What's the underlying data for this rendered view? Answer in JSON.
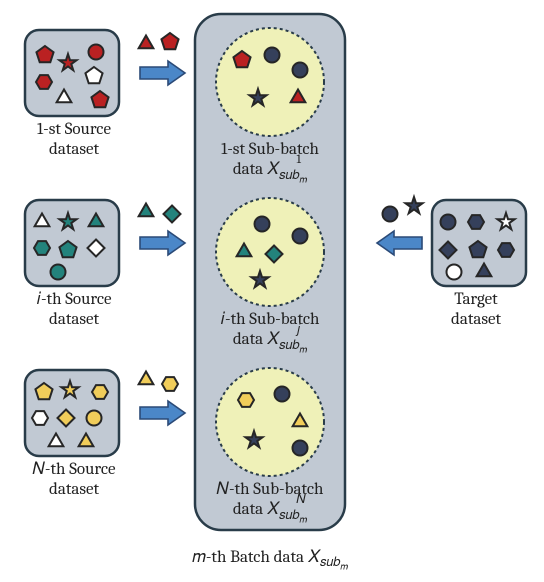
{
  "labels": {
    "source1": "1-st Source",
    "source1b": "dataset",
    "sourcei": "𝑖-th Source",
    "sourceib": "dataset",
    "sourceN": "𝑁-th Source",
    "sourceNb": "dataset",
    "target": "Target",
    "targetb": "dataset",
    "sub1a": "1-st Sub-batch",
    "sub1b": "data 𝑋",
    "sub1sup": "1",
    "sub1sub": "𝑠𝑢𝑏",
    "sub1subm": "𝑚",
    "subia": "𝑖-th Sub-batch",
    "subib": "data 𝑋",
    "subisup": "𝑗",
    "subisub": "𝑠𝑢𝑏",
    "subisubm": "𝑚",
    "subNa": "𝑁-th Sub-batch",
    "subNb": "data 𝑋",
    "subNsup": "𝑁",
    "subNsub": "𝑠𝑢𝑏",
    "subNsubm": "𝑚",
    "batcha": "𝑚-th Batch data 𝑋",
    "batchsub": "𝑠𝑢𝑏",
    "batchsubm": "𝑚"
  },
  "colors": {
    "boxFill": "#c1c9d3",
    "boxStroke": "#293c49",
    "batchFill": "#c1c9d3",
    "subFill": "#eff1b8",
    "arrowFill": "#4b87c8",
    "arrowStroke": "#2b4a77",
    "red": "#ba2122",
    "teal": "#23837c",
    "yellow": "#f1cd5a",
    "navy": "#35405b",
    "white": "#ffffff",
    "black": "#262626"
  }
}
